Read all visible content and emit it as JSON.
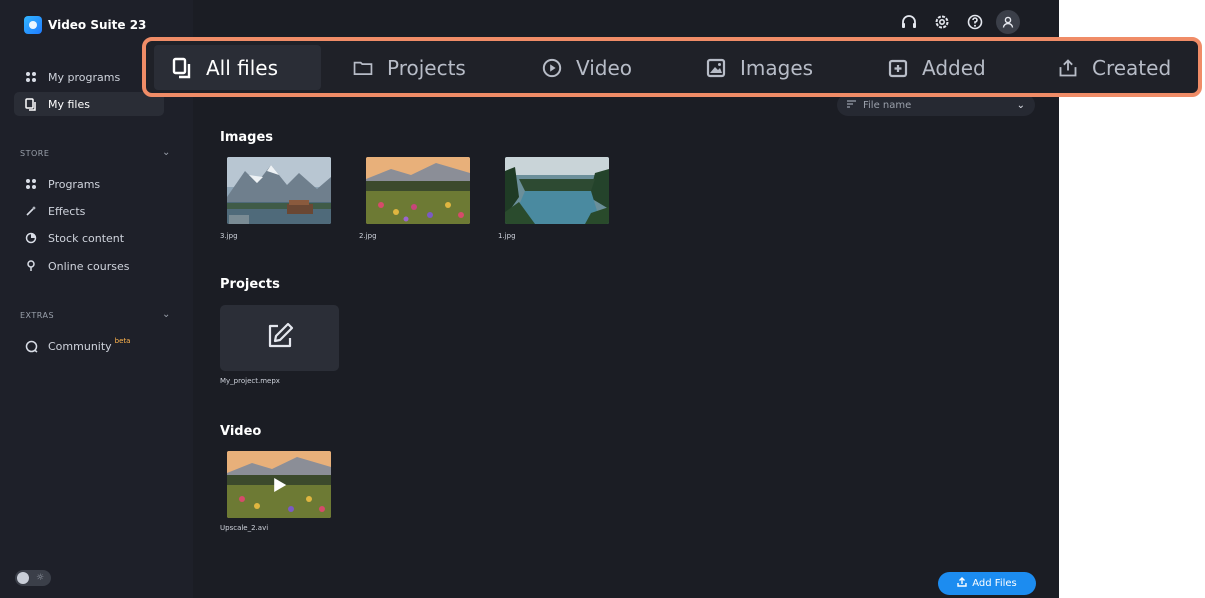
{
  "app": {
    "title": "Video Suite 23"
  },
  "sidebar": {
    "items": [
      {
        "label": "My programs",
        "icon": "grid-icon"
      },
      {
        "label": "My files",
        "icon": "files-icon",
        "active": true
      }
    ],
    "store": {
      "label": "STORE",
      "items": [
        {
          "label": "Programs",
          "icon": "grid-icon"
        },
        {
          "label": "Effects",
          "icon": "magic-wand-icon"
        },
        {
          "label": "Stock content",
          "icon": "pie-icon"
        },
        {
          "label": "Online courses",
          "icon": "location-pin-icon"
        }
      ]
    },
    "extras": {
      "label": "EXTRAS",
      "items": [
        {
          "label": "Community",
          "badge": "beta",
          "icon": "chat-bubble-icon"
        }
      ]
    }
  },
  "header_icons": [
    "headset-icon",
    "gear-icon",
    "help-icon",
    "user-icon"
  ],
  "tabs": [
    {
      "label": "All files",
      "icon": "files-icon",
      "active": true
    },
    {
      "label": "Projects",
      "icon": "folder-icon"
    },
    {
      "label": "Video",
      "icon": "play-circle-icon"
    },
    {
      "label": "Images",
      "icon": "image-icon"
    },
    {
      "label": "Added",
      "icon": "add-folder-icon"
    },
    {
      "label": "Created",
      "icon": "share-icon"
    }
  ],
  "sort": {
    "label": "File name"
  },
  "sections": {
    "images": {
      "title": "Images",
      "files": [
        {
          "name": "3.jpg"
        },
        {
          "name": "2.jpg"
        },
        {
          "name": "1.jpg"
        }
      ]
    },
    "projects": {
      "title": "Projects",
      "files": [
        {
          "name": "My_project.mepx"
        }
      ]
    },
    "video": {
      "title": "Video",
      "files": [
        {
          "name": "Upscale_2.avi"
        }
      ]
    }
  },
  "add_files": {
    "label": "Add Files"
  },
  "colors": {
    "accent": "#1c8cf0",
    "highlight": "#f08c67",
    "beta": "#ffb44d"
  }
}
